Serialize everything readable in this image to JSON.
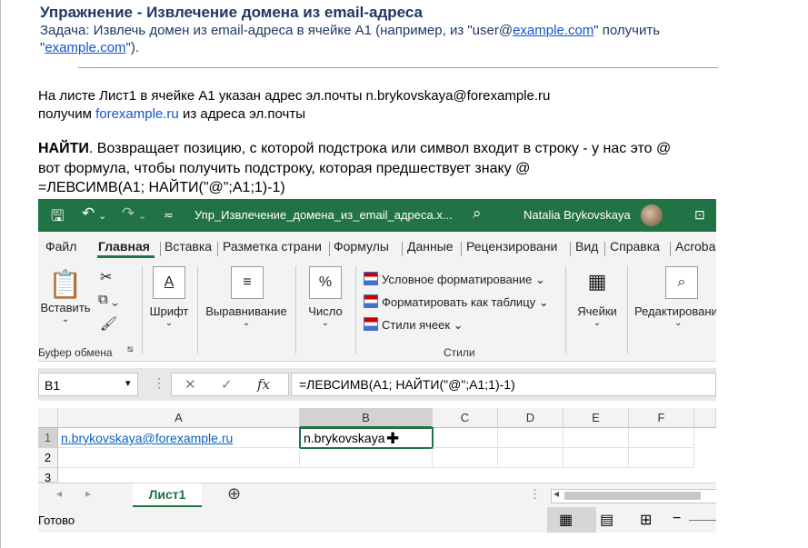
{
  "doc": {
    "title": "Упражнение - Извлечение домена из email-адреса",
    "task_prefix": "Задача: Извлечь домен из email-адреса в ячейке A1 (например, из \"user@",
    "task_link1": "example.com",
    "task_mid": "\" получить \"",
    "task_link2": "example.com",
    "task_end": "\").",
    "line1": "На листе Лист1 в ячейке A1 указан адрес эл.почты n.brykovskaya@forexample.ru",
    "line2_pre": "получим ",
    "line2_blue": "forexample.ru",
    "line2_post": " из адреса эл.почты",
    "line3_bold": "НАЙТИ",
    "line3_rest": ". Возвращает позицию, с которой подстрока или символ входит в строку - у нас это @",
    "line4": "вот  формула, чтобы получить подстроку, которая предшествует знаку @",
    "line5": "=ЛЕВСИМВ(A1; НАЙТИ(\"@\";A1;1)-1)"
  },
  "excel": {
    "accent": "#217346",
    "window_title": "Упр_Извлечение_домена_из_email_адреса.x...",
    "user": "Natalia Brykovskaya",
    "tabs": [
      "Файл",
      "Главная",
      "Вставка",
      "Разметка страни",
      "Формулы",
      "Данные",
      "Рецензировани",
      "Вид",
      "Справка",
      "Acroba"
    ],
    "ribbon": {
      "paste": "Вставить",
      "clipboard": "Буфер обмена",
      "font": "Шрифт",
      "align": "Выравнивание",
      "number": "Число",
      "cond_format": "Условное форматирование",
      "format_table": "Форматировать как таблицу",
      "cell_styles": "Стили ячеек",
      "styles": "Стили",
      "cells": "Ячейки",
      "editing": "Редактировани"
    },
    "name_box": "B1",
    "formula": "=ЛЕВСИМВ(A1; НАЙТИ(\"@\";A1;1)-1)",
    "columns": [
      "A",
      "B",
      "C",
      "D",
      "E",
      "F"
    ],
    "rows": [
      "1",
      "2",
      "3"
    ],
    "cell_a1": "n.brykovskaya@forexample.ru",
    "cell_b1": "n.brykovskaya",
    "sheet": "Лист1",
    "status": "Готово"
  }
}
